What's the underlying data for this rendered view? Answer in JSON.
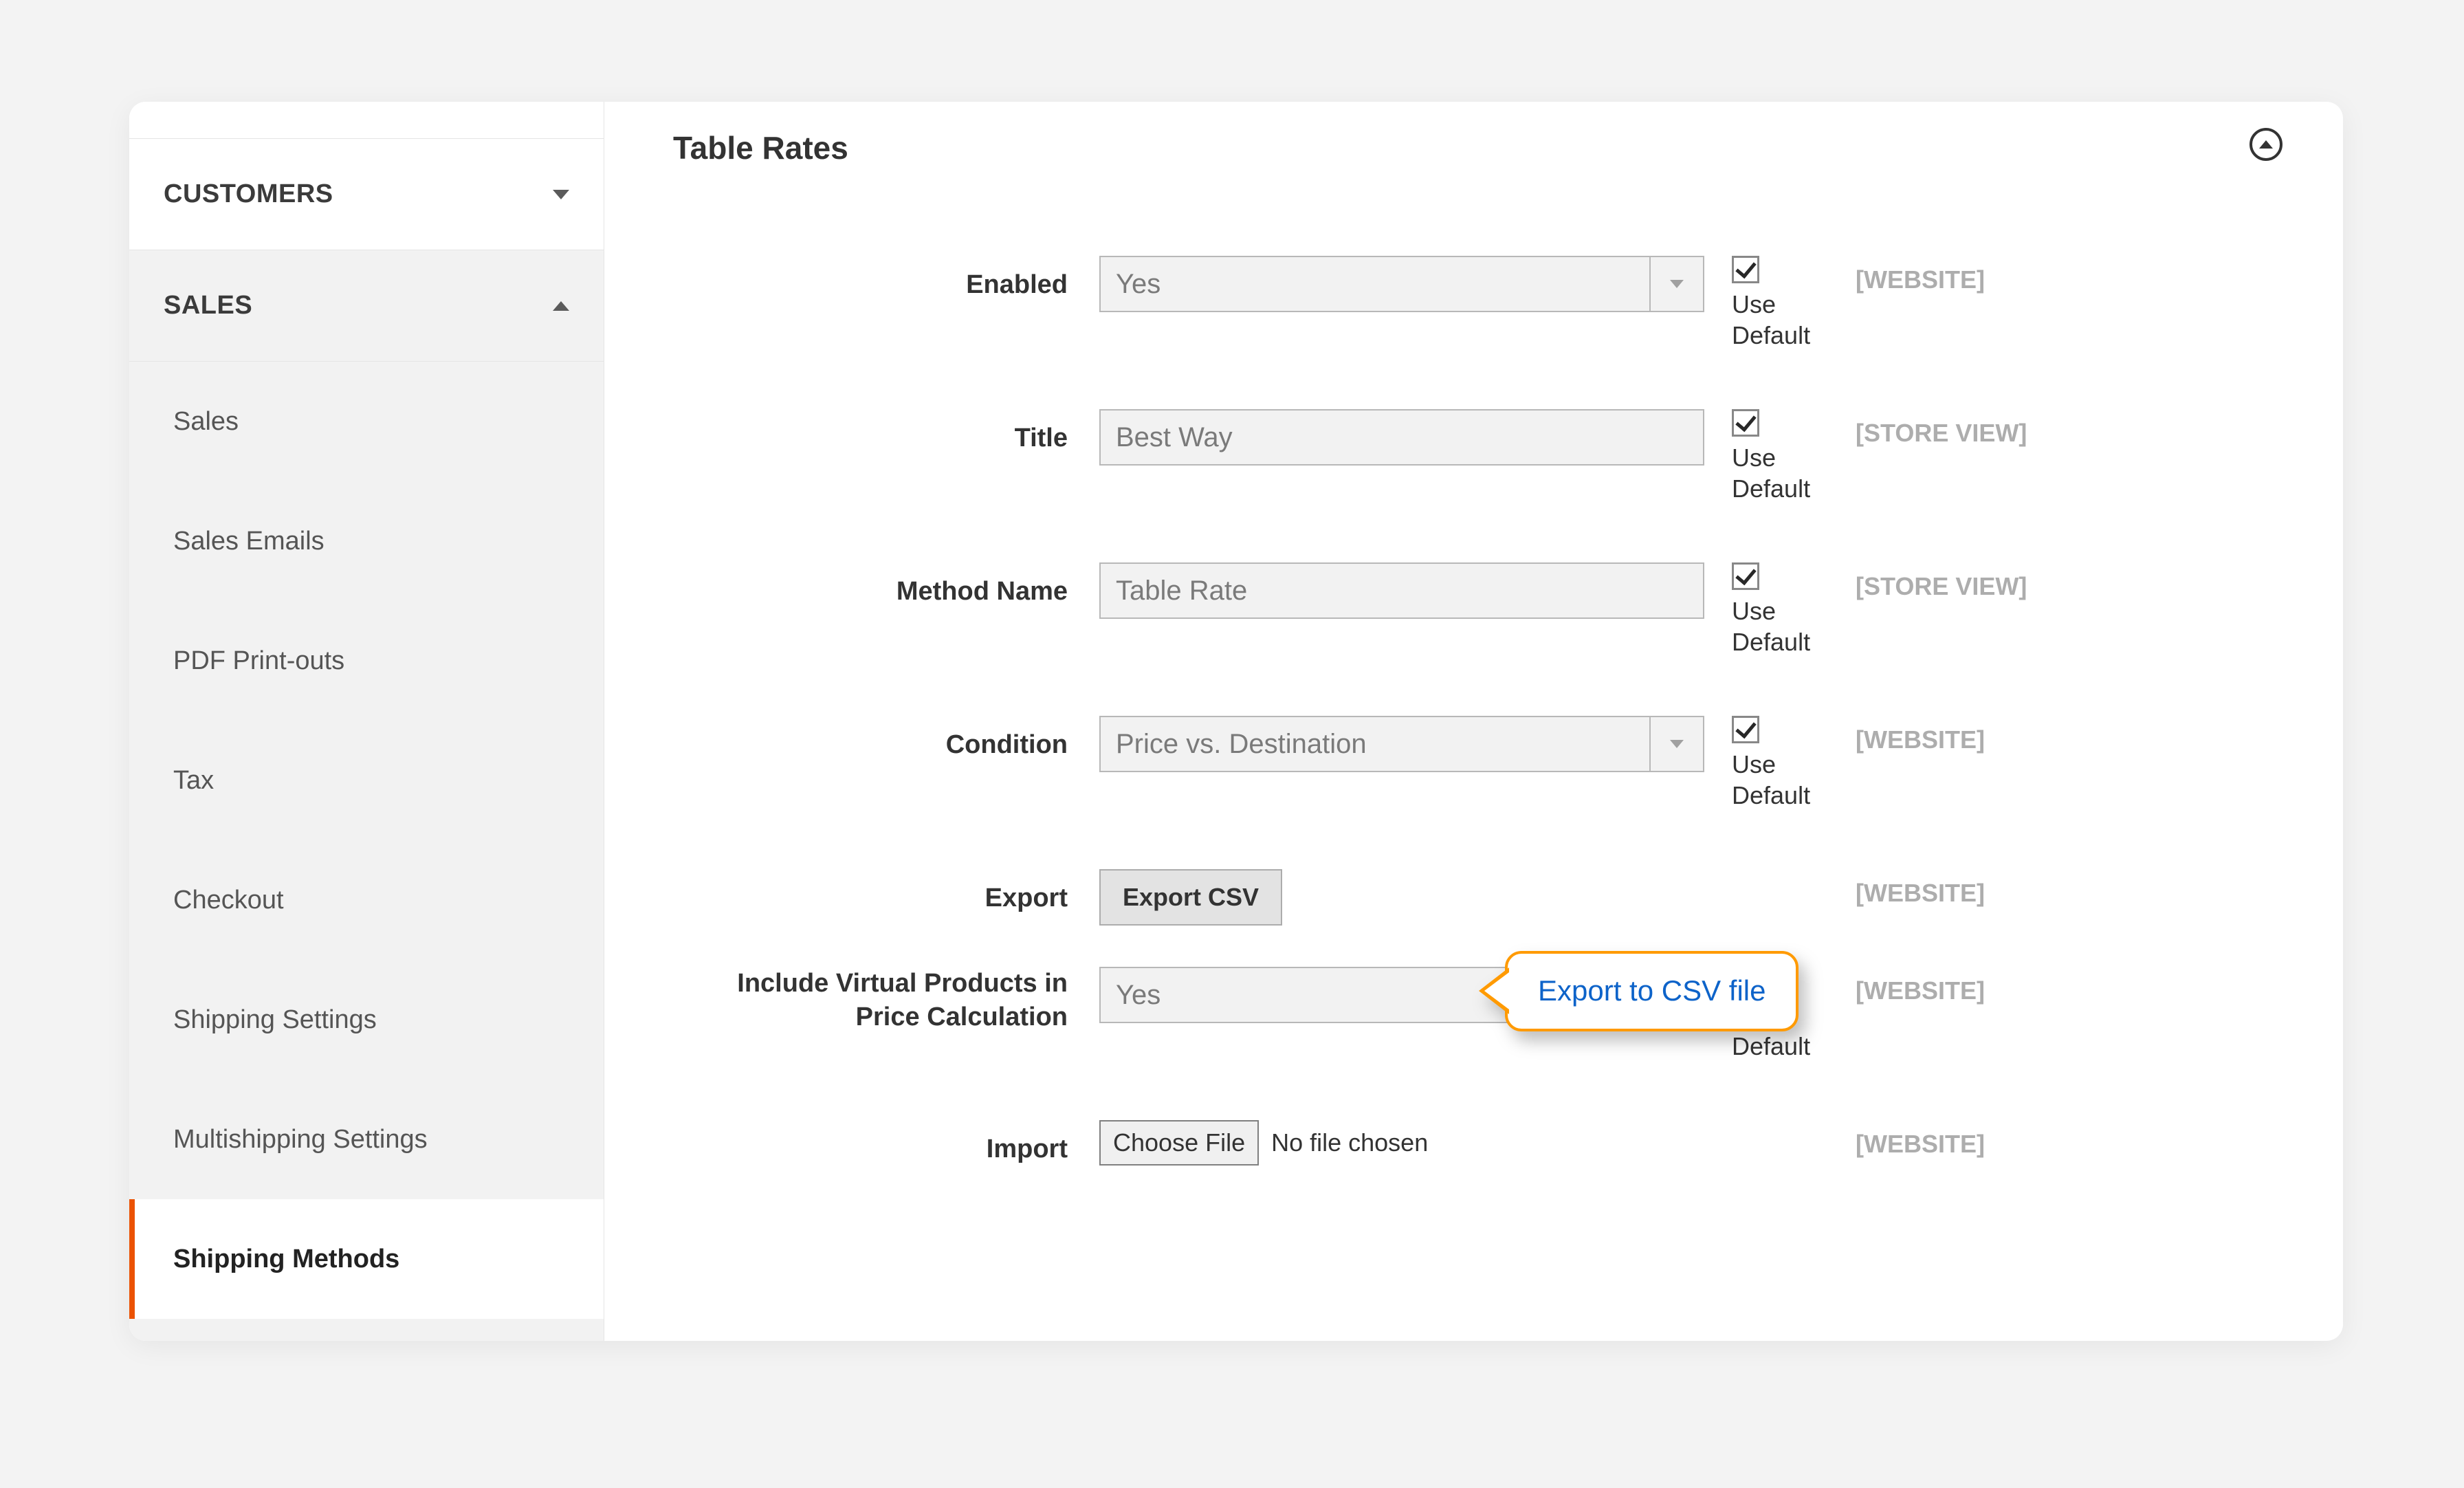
{
  "sidebar": {
    "customers_label": "CUSTOMERS",
    "sales_label": "SALES",
    "items": [
      {
        "label": "Sales"
      },
      {
        "label": "Sales Emails"
      },
      {
        "label": "PDF Print-outs"
      },
      {
        "label": "Tax"
      },
      {
        "label": "Checkout"
      },
      {
        "label": "Shipping Settings"
      },
      {
        "label": "Multishipping Settings"
      },
      {
        "label": "Shipping Methods"
      }
    ]
  },
  "section_title": "Table Rates",
  "use_default_label": "Use Default",
  "fields": {
    "enabled": {
      "label": "Enabled",
      "value": "Yes",
      "scope": "[WEBSITE]"
    },
    "title": {
      "label": "Title",
      "value": "Best Way",
      "scope": "[STORE VIEW]"
    },
    "method_name": {
      "label": "Method Name",
      "value": "Table Rate",
      "scope": "[STORE VIEW]"
    },
    "condition": {
      "label": "Condition",
      "value": "Price vs. Destination",
      "scope": "[WEBSITE]"
    },
    "export": {
      "label": "Export",
      "button": "Export CSV",
      "scope": "[WEBSITE]"
    },
    "include_virtual": {
      "label": "Include Virtual Products in Price Calculation",
      "value": "Yes",
      "scope": "[WEBSITE]"
    },
    "import": {
      "label": "Import",
      "button": "Choose File",
      "file_status": "No file chosen",
      "scope": "[WEBSITE]"
    }
  },
  "callout_text": "Export to CSV file"
}
